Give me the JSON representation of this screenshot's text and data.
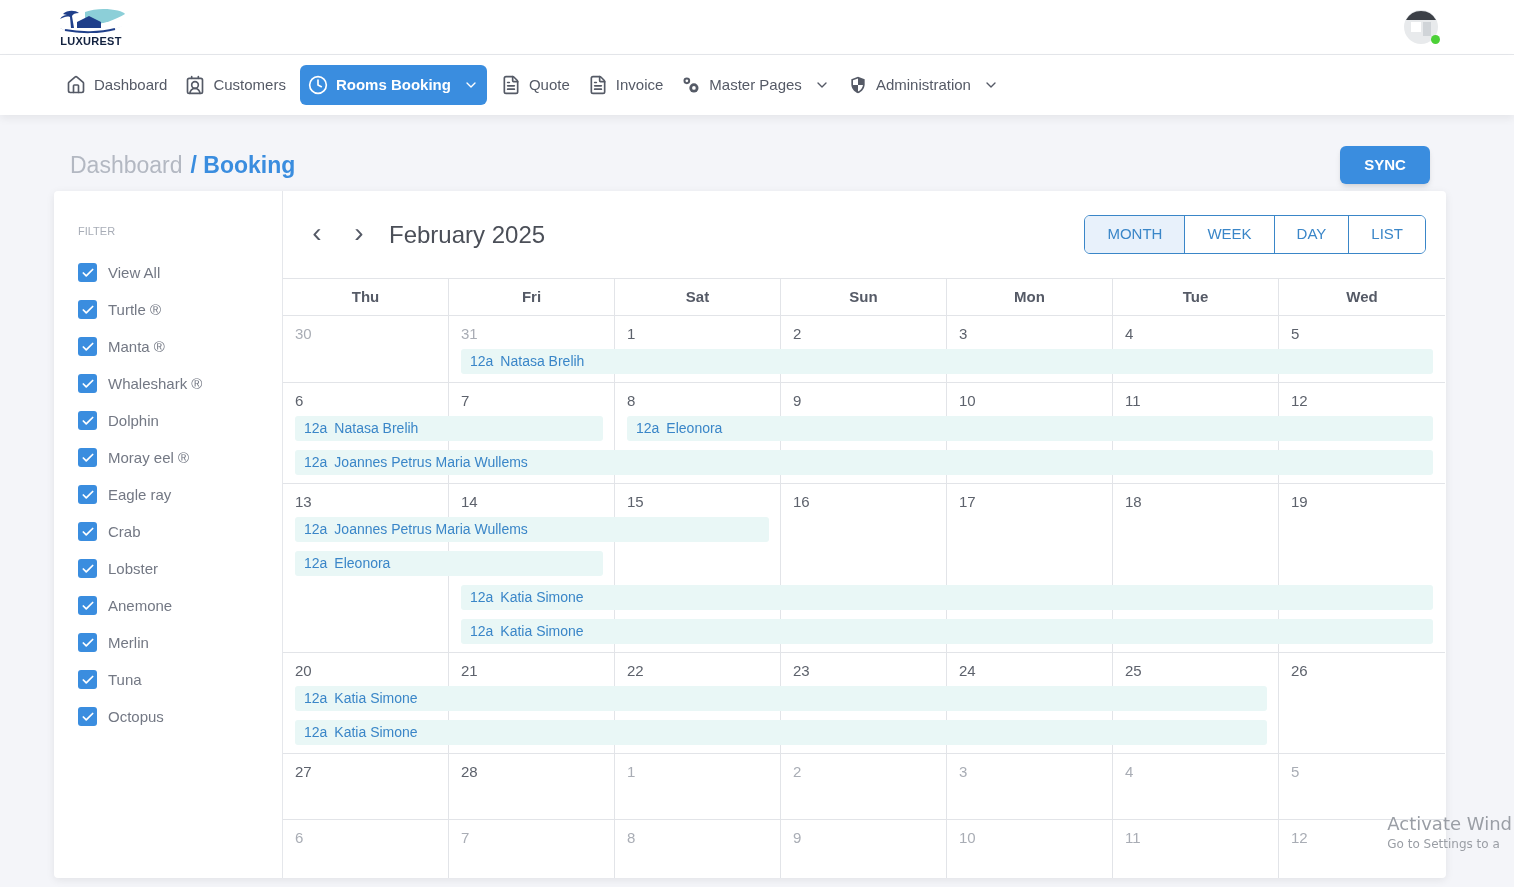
{
  "brand": {
    "name": "LUXUREST"
  },
  "user": {
    "online": true
  },
  "nav": [
    {
      "label": "Dashboard",
      "selected": false,
      "dropdown": false
    },
    {
      "label": "Customers",
      "selected": false,
      "dropdown": false
    },
    {
      "label": "Rooms Booking",
      "selected": true,
      "dropdown": true
    },
    {
      "label": "Quote",
      "selected": false,
      "dropdown": false
    },
    {
      "label": "Invoice",
      "selected": false,
      "dropdown": false
    },
    {
      "label": "Master Pages",
      "selected": false,
      "dropdown": true
    },
    {
      "label": "Administration",
      "selected": false,
      "dropdown": true
    }
  ],
  "breadcrumb": {
    "parent": "Dashboard",
    "current": "/ Booking"
  },
  "sync_button": "SYNC",
  "filter": {
    "title": "FILTER",
    "items": [
      {
        "label": "View All",
        "checked": true
      },
      {
        "label": "Turtle ®",
        "checked": true
      },
      {
        "label": "Manta ®",
        "checked": true
      },
      {
        "label": "Whaleshark ®",
        "checked": true
      },
      {
        "label": "Dolphin",
        "checked": true
      },
      {
        "label": "Moray eel ®",
        "checked": true
      },
      {
        "label": "Eagle ray",
        "checked": true
      },
      {
        "label": "Crab",
        "checked": true
      },
      {
        "label": "Lobster",
        "checked": true
      },
      {
        "label": "Anemone",
        "checked": true
      },
      {
        "label": "Merlin",
        "checked": true
      },
      {
        "label": "Tuna",
        "checked": true
      },
      {
        "label": "Octopus",
        "checked": true
      }
    ]
  },
  "calendar": {
    "prev": "‹",
    "next": "›",
    "title": "February 2025",
    "views": [
      {
        "label": "MONTH",
        "selected": true
      },
      {
        "label": "WEEK",
        "selected": false
      },
      {
        "label": "DAY",
        "selected": false
      },
      {
        "label": "LIST",
        "selected": false
      }
    ],
    "weekdays": [
      "Thu",
      "Fri",
      "Sat",
      "Sun",
      "Mon",
      "Tue",
      "Wed"
    ],
    "weeks": [
      {
        "days": [
          {
            "number": "30",
            "muted": true
          },
          {
            "number": "31",
            "muted": true
          },
          {
            "number": "1",
            "muted": false
          },
          {
            "number": "2",
            "muted": false
          },
          {
            "number": "3",
            "muted": false
          },
          {
            "number": "4",
            "muted": false
          },
          {
            "number": "5",
            "muted": false
          }
        ],
        "lanes": [
          [
            {
              "kind": "empty"
            },
            {
              "kind": "start",
              "time": "12a",
              "title": "Natasa Brelih"
            },
            {
              "kind": "continued"
            },
            {
              "kind": "continued"
            },
            {
              "kind": "continued"
            },
            {
              "kind": "continued"
            },
            {
              "kind": "continued"
            }
          ]
        ]
      },
      {
        "days": [
          {
            "number": "6",
            "muted": false
          },
          {
            "number": "7",
            "muted": false
          },
          {
            "number": "8",
            "muted": false
          },
          {
            "number": "9",
            "muted": false
          },
          {
            "number": "10",
            "muted": false
          },
          {
            "number": "11",
            "muted": false
          },
          {
            "number": "12",
            "muted": false
          }
        ],
        "lanes": [
          [
            {
              "kind": "start",
              "time": "12a",
              "title": "Natasa Brelih"
            },
            {
              "kind": "continued"
            },
            {
              "kind": "start",
              "time": "12a",
              "title": "Eleonora"
            },
            {
              "kind": "continued"
            },
            {
              "kind": "continued"
            },
            {
              "kind": "continued"
            },
            {
              "kind": "continued"
            }
          ],
          [
            {
              "kind": "start",
              "time": "12a",
              "title": "Joannes Petrus Maria Wullems"
            },
            {
              "kind": "continued"
            },
            {
              "kind": "continued"
            },
            {
              "kind": "continued"
            },
            {
              "kind": "continued"
            },
            {
              "kind": "continued"
            },
            {
              "kind": "continued"
            }
          ]
        ]
      },
      {
        "days": [
          {
            "number": "13",
            "muted": false
          },
          {
            "number": "14",
            "muted": false
          },
          {
            "number": "15",
            "muted": false
          },
          {
            "number": "16",
            "muted": false
          },
          {
            "number": "17",
            "muted": false
          },
          {
            "number": "18",
            "muted": false
          },
          {
            "number": "19",
            "muted": false
          }
        ],
        "lanes": [
          [
            {
              "kind": "start",
              "time": "12a",
              "title": "Joannes Petrus Maria Wullems"
            },
            {
              "kind": "continued"
            },
            {
              "kind": "continued"
            },
            {
              "kind": "empty"
            },
            {
              "kind": "empty"
            },
            {
              "kind": "empty"
            },
            {
              "kind": "empty"
            }
          ],
          [
            {
              "kind": "start",
              "time": "12a",
              "title": "Eleonora"
            },
            {
              "kind": "continued"
            },
            {
              "kind": "empty"
            },
            {
              "kind": "empty"
            },
            {
              "kind": "empty"
            },
            {
              "kind": "empty"
            },
            {
              "kind": "empty"
            }
          ],
          [
            {
              "kind": "empty"
            },
            {
              "kind": "start",
              "time": "12a",
              "title": "Katia Simone"
            },
            {
              "kind": "continued"
            },
            {
              "kind": "continued"
            },
            {
              "kind": "continued"
            },
            {
              "kind": "continued"
            },
            {
              "kind": "continued"
            }
          ],
          [
            {
              "kind": "empty"
            },
            {
              "kind": "start",
              "time": "12a",
              "title": "Katia Simone"
            },
            {
              "kind": "continued"
            },
            {
              "kind": "continued"
            },
            {
              "kind": "continued"
            },
            {
              "kind": "continued"
            },
            {
              "kind": "continued"
            }
          ]
        ]
      },
      {
        "days": [
          {
            "number": "20",
            "muted": false
          },
          {
            "number": "21",
            "muted": false
          },
          {
            "number": "22",
            "muted": false
          },
          {
            "number": "23",
            "muted": false
          },
          {
            "number": "24",
            "muted": false
          },
          {
            "number": "25",
            "muted": false
          },
          {
            "number": "26",
            "muted": false
          }
        ],
        "lanes": [
          [
            {
              "kind": "start",
              "time": "12a",
              "title": "Katia Simone"
            },
            {
              "kind": "continued"
            },
            {
              "kind": "continued"
            },
            {
              "kind": "continued"
            },
            {
              "kind": "continued"
            },
            {
              "kind": "continued"
            },
            {
              "kind": "empty"
            }
          ],
          [
            {
              "kind": "start",
              "time": "12a",
              "title": "Katia Simone"
            },
            {
              "kind": "continued"
            },
            {
              "kind": "continued"
            },
            {
              "kind": "continued"
            },
            {
              "kind": "continued"
            },
            {
              "kind": "continued"
            },
            {
              "kind": "empty"
            }
          ]
        ]
      },
      {
        "days": [
          {
            "number": "27",
            "muted": false
          },
          {
            "number": "28",
            "muted": false
          },
          {
            "number": "1",
            "muted": true
          },
          {
            "number": "2",
            "muted": true
          },
          {
            "number": "3",
            "muted": true
          },
          {
            "number": "4",
            "muted": true
          },
          {
            "number": "5",
            "muted": true
          }
        ]
      },
      {
        "days": [
          {
            "number": "6",
            "muted": true
          },
          {
            "number": "7",
            "muted": true
          },
          {
            "number": "8",
            "muted": true
          },
          {
            "number": "9",
            "muted": true
          },
          {
            "number": "10",
            "muted": true
          },
          {
            "number": "11",
            "muted": true
          },
          {
            "number": "12",
            "muted": true
          }
        ]
      }
    ]
  },
  "os_notice": {
    "title": "Activate Wind",
    "subtitle": "Go to Settings to a"
  }
}
